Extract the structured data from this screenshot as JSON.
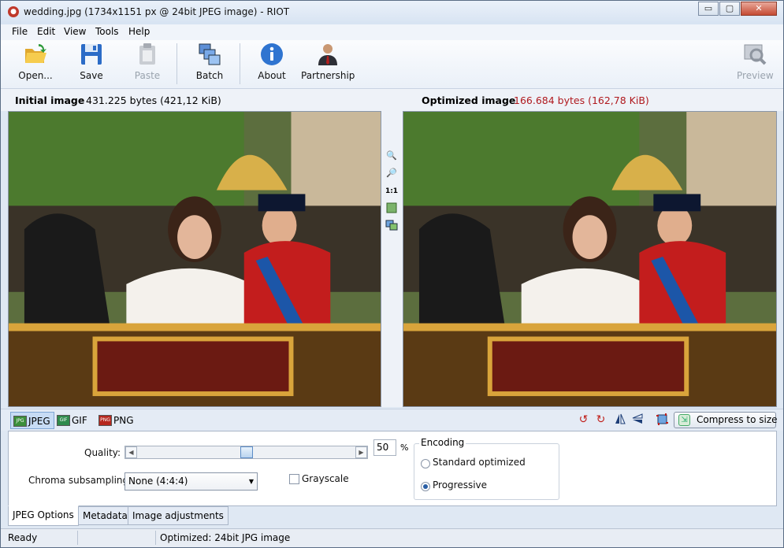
{
  "window": {
    "title": "wedding.jpg (1734x1151 px @ 24bit JPEG image) - RIOT",
    "app_icon": "riot-app-icon",
    "controls": {
      "minimize": "▭",
      "maximize": "▢",
      "close": "✕"
    }
  },
  "menu": [
    "File",
    "Edit",
    "View",
    "Tools",
    "Help"
  ],
  "toolbar": {
    "open": {
      "label": "Open...",
      "icon": "folder-open-icon"
    },
    "save": {
      "label": "Save",
      "icon": "floppy-disk-icon"
    },
    "paste": {
      "label": "Paste",
      "icon": "clipboard-icon"
    },
    "batch": {
      "label": "Batch",
      "icon": "batch-images-icon"
    },
    "about": {
      "label": "About",
      "icon": "info-icon"
    },
    "partnership": {
      "label": "Partnership",
      "icon": "person-icon"
    },
    "preview": {
      "label": "Preview",
      "icon": "magnify-preview-icon"
    }
  },
  "info": {
    "initial_label": "Initial image",
    "initial_size": "431.225 bytes (421,12 KiB)",
    "optimized_label": "Optimized image",
    "optimized_size": "166.684 bytes (162,78 KiB)"
  },
  "midcontrols": {
    "zoom_in": "zoom-in-icon",
    "zoom_out": "zoom-out-icon",
    "actual": "1:1",
    "fit": "fit-window-icon",
    "compare": "compare-icon"
  },
  "formats": {
    "jpeg": "JPEG",
    "gif": "GIF",
    "png": "PNG"
  },
  "format_icon_labels": {
    "jpeg": "JPG",
    "gif": "GIF",
    "png": "PNG"
  },
  "compress_label": "Compress to size",
  "options": {
    "quality_label": "Quality:",
    "quality_value": "50",
    "quality_fraction": 0.5,
    "percent_sign": "%",
    "chroma_label": "Chroma subsampling:",
    "chroma_value": "None (4:4:4)",
    "grayscale_label": "Grayscale",
    "encoding_legend": "Encoding",
    "standard_label": "Standard optimized",
    "progressive_label": "Progressive"
  },
  "tabs": [
    "JPEG Options",
    "Metadata",
    "Image adjustments"
  ],
  "status": {
    "left": "Ready",
    "right": "Optimized: 24bit JPG image"
  },
  "colors": {
    "accent_red": "#b0191e"
  }
}
